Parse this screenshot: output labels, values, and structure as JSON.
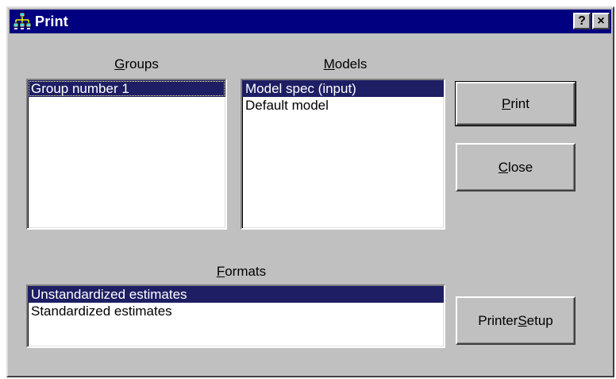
{
  "window": {
    "title": "Print"
  },
  "titlebar": {
    "help_label": "?",
    "close_label": "×"
  },
  "groups": {
    "label_mnemonic": "G",
    "label_rest": "roups",
    "items": [
      "Group number 1"
    ]
  },
  "models": {
    "label_mnemonic": "M",
    "label_rest": "odels",
    "items": [
      "Model spec (input)",
      "Default model"
    ]
  },
  "formats": {
    "label_mnemonic": "F",
    "label_rest": "ormats",
    "items": [
      "Unstandardized estimates",
      "Standardized estimates"
    ]
  },
  "buttons": {
    "print_mnemonic": "P",
    "print_rest": "rint",
    "close_mnemonic": "C",
    "close_rest": "lose",
    "setup_pre": "Printer ",
    "setup_mnemonic": "S",
    "setup_rest": "etup"
  },
  "colors": {
    "titlebar": "#000080",
    "face": "#c0c0c0",
    "selection": "#1e1e64"
  }
}
